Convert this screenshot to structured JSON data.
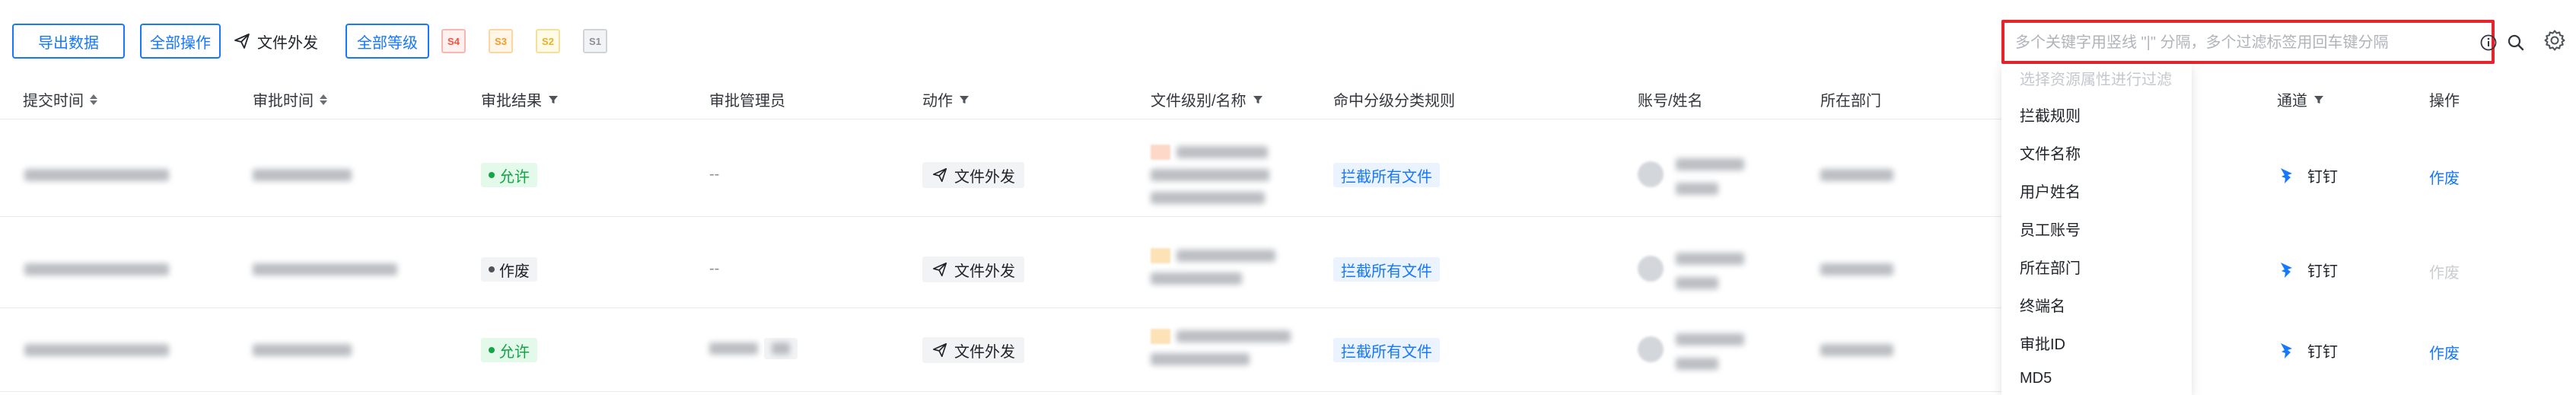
{
  "toolbar": {
    "export_label": "导出数据",
    "all_actions_label": "全部操作",
    "file_send_label": "文件外发",
    "all_levels_label": "全部等级",
    "levels": [
      {
        "label": "S4",
        "color": "#f5533d",
        "bg": "#fff1ef"
      },
      {
        "label": "S3",
        "color": "#f59a23",
        "bg": "#fff6e8"
      },
      {
        "label": "S2",
        "color": "#e8b12a",
        "bg": "#fffbe6"
      },
      {
        "label": "S1",
        "color": "#8a8f96",
        "bg": "#f2f3f5"
      }
    ]
  },
  "search": {
    "placeholder": "多个关键字用竖线 \"|\" 分隔，多个过滤标签用回车键分隔"
  },
  "table": {
    "headers": {
      "submit_time": "提交时间",
      "approve_time": "审批时间",
      "result": "审批结果",
      "admin": "审批管理员",
      "action": "动作",
      "file": "文件级别/名称",
      "rule": "命中分级分类规则",
      "account": "账号/姓名",
      "department": "所在部门",
      "channel": "通道",
      "operation": "操作"
    },
    "rows": [
      {
        "result": "允许",
        "admin": "--",
        "action": "文件外发",
        "file_level": "S4",
        "rule": "拦截所有文件",
        "channel": "钉钉",
        "operation": "作废"
      },
      {
        "result": "作废",
        "admin": "--",
        "action": "文件外发",
        "file_level": "S3",
        "rule": "拦截所有文件",
        "channel": "钉钉",
        "operation": "作废"
      },
      {
        "result": "允许",
        "admin": "",
        "action": "文件外发",
        "file_level": "S3",
        "rule": "拦截所有文件",
        "channel": "钉钉",
        "operation": "作废"
      }
    ]
  },
  "dropdown": {
    "hint": "选择资源属性进行过滤",
    "items": [
      "拦截规则",
      "文件名称",
      "用户姓名",
      "员工账号",
      "所在部门",
      "终端名",
      "审批ID",
      "MD5"
    ]
  },
  "colors": {
    "accent": "#1677ff",
    "allow_green": "#16a34a",
    "search_border": "#e5242b"
  }
}
